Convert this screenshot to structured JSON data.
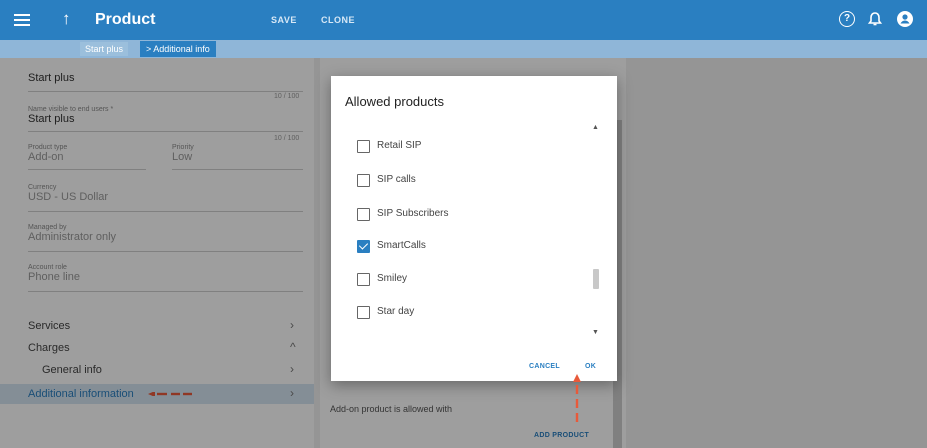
{
  "header": {
    "title": "Product",
    "save_label": "SAVE",
    "clone_label": "CLONE",
    "help_glyph": "?"
  },
  "breadcrumb": {
    "items": [
      "Start plus",
      "> Additional info"
    ]
  },
  "form": {
    "name_value": "Start plus",
    "name_counter": "10 / 100",
    "visible_label": "Name visible to end users *",
    "visible_value": "Start plus",
    "visible_counter": "10 / 100",
    "type_label": "Product type",
    "type_value": "Add-on",
    "priority_label": "Priority",
    "priority_value": "Low",
    "currency_label": "Currency",
    "currency_value": "USD - US Dollar",
    "managed_label": "Managed by",
    "managed_value": "Administrator only",
    "role_label": "Account role",
    "role_value": "Phone line"
  },
  "nav": {
    "services": "Services",
    "charges": "Charges",
    "general_info": "General info",
    "additional_information": "Additional information",
    "chevron_right": "›",
    "chevron_up": "^"
  },
  "background_panel": {
    "addon_text": "Add-on product is allowed with",
    "add_product_label": "ADD PRODUCT"
  },
  "dialog": {
    "title": "Allowed products",
    "items": [
      {
        "label": "Retail SIP",
        "checked": false
      },
      {
        "label": "SIP calls",
        "checked": false
      },
      {
        "label": "SIP Subscribers",
        "checked": false
      },
      {
        "label": "SmartCalls",
        "checked": true
      },
      {
        "label": "Smiley",
        "checked": false
      },
      {
        "label": "Star day",
        "checked": false
      }
    ],
    "cancel_label": "CANCEL",
    "ok_label": "OK",
    "scroll_up_glyph": "▲",
    "scroll_down_glyph": "▼"
  },
  "colors": {
    "accent": "#2a7fc1",
    "annotation": "#e85a3a"
  }
}
